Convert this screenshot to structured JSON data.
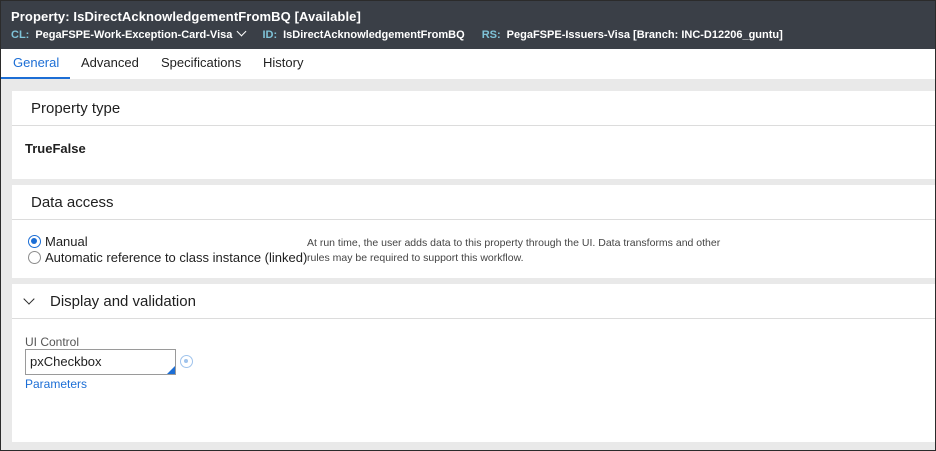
{
  "header": {
    "title": "Property: IsDirectAcknowledgementFromBQ",
    "status": "[Available]",
    "cl_label": "CL:",
    "cl_value": "PegaFSPE-Work-Exception-Card-Visa",
    "id_label": "ID:",
    "id_value": "IsDirectAcknowledgementFromBQ",
    "rs_label": "RS:",
    "rs_value": "PegaFSPE-Issuers-Visa [Branch: INC-D12206_guntu]"
  },
  "tabs": [
    "General",
    "Advanced",
    "Specifications",
    "History"
  ],
  "active_tab": "General",
  "property_type": {
    "heading": "Property type",
    "value": "TrueFalse"
  },
  "data_access": {
    "heading": "Data access",
    "options": [
      {
        "label": "Manual",
        "selected": true
      },
      {
        "label": "Automatic reference to class instance (linked)",
        "selected": false
      }
    ],
    "help_text": "At run time, the user adds data to this property through the UI. Data transforms and other rules may be required to support this workflow."
  },
  "display_validation": {
    "heading": "Display and validation",
    "ui_control_label": "UI Control",
    "ui_control_value": "pxCheckbox",
    "parameters_link": "Parameters"
  },
  "colors": {
    "header_bg": "#3a3f47",
    "header_key": "#7fc3d8",
    "accent": "#1c6ed5",
    "page_bg": "#e9e9e9"
  }
}
